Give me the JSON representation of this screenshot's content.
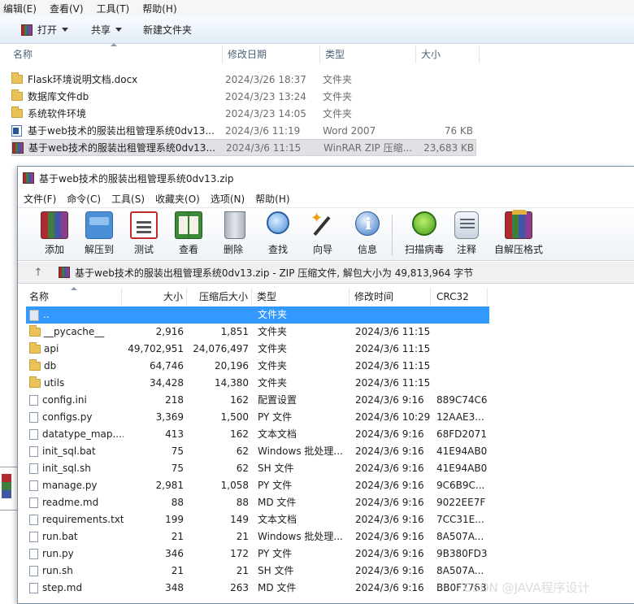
{
  "explorer": {
    "menu": [
      "编辑(E)",
      "查看(V)",
      "工具(T)",
      "帮助(H)"
    ],
    "toolbar": {
      "open": "打开",
      "share": "共享",
      "new_folder": "新建文件夹"
    },
    "columns": {
      "name": "名称",
      "date": "修改日期",
      "type": "类型",
      "size": "大小"
    },
    "rows": [
      {
        "name": "Flask环境说明文档.docx",
        "date": "2024/3/26 18:37",
        "type": "文件夹",
        "size": "",
        "icon": "folder-icon"
      },
      {
        "name": "数据库文件db",
        "date": "2024/3/23 13:24",
        "type": "文件夹",
        "size": "",
        "icon": "folder-icon"
      },
      {
        "name": "系统软件环境",
        "date": "2024/3/23 14:05",
        "type": "文件夹",
        "size": "",
        "icon": "folder-icon"
      },
      {
        "name": "基于web技术的服装出租管理系统0dv13...",
        "date": "2024/3/6 11:19",
        "type": "Word 2007",
        "size": "76 KB",
        "icon": "word-doc-icon"
      },
      {
        "name": "基于web技术的服装出租管理系统0dv13...",
        "date": "2024/3/6 11:15",
        "type": "WinRAR ZIP 压缩...",
        "size": "23,683 KB",
        "icon": "winrar-archive-icon"
      }
    ]
  },
  "winrar": {
    "title": "基于web技术的服装出租管理系统0dv13.zip",
    "menu": [
      "文件(F)",
      "命令(C)",
      "工具(S)",
      "收藏夹(O)",
      "选项(N)",
      "帮助(H)"
    ],
    "tools": [
      {
        "label": "添加",
        "icon": "add-archive-icon"
      },
      {
        "label": "解压到",
        "icon": "extract-to-icon"
      },
      {
        "label": "测试",
        "icon": "test-icon"
      },
      {
        "label": "查看",
        "icon": "view-book-icon"
      },
      {
        "label": "删除",
        "icon": "trash-icon"
      },
      {
        "label": "查找",
        "icon": "magnifier-icon"
      },
      {
        "label": "向导",
        "icon": "wizard-wand-icon"
      },
      {
        "label": "信息",
        "icon": "info-icon"
      },
      {
        "label": "扫描病毒",
        "icon": "virus-scan-icon"
      },
      {
        "label": "注释",
        "icon": "comment-icon"
      },
      {
        "label": "自解压格式",
        "icon": "sfx-icon"
      }
    ],
    "path": "基于web技术的服装出租管理系统0dv13.zip - ZIP 压缩文件, 解包大小为 49,813,964 字节",
    "columns": {
      "name": "名称",
      "size": "大小",
      "packed": "压缩后大小",
      "type": "类型",
      "modified": "修改时间",
      "crc": "CRC32"
    },
    "rows": [
      {
        "name": "..",
        "size": "",
        "packed": "",
        "type": "文件夹",
        "modified": "",
        "crc": "",
        "icon": "parent-folder-icon"
      },
      {
        "name": "__pycache__",
        "size": "2,916",
        "packed": "1,851",
        "type": "文件夹",
        "modified": "2024/3/6 11:15",
        "crc": "",
        "icon": "folder-icon"
      },
      {
        "name": "api",
        "size": "49,702,951",
        "packed": "24,076,497",
        "type": "文件夹",
        "modified": "2024/3/6 11:15",
        "crc": "",
        "icon": "folder-icon"
      },
      {
        "name": "db",
        "size": "64,746",
        "packed": "20,196",
        "type": "文件夹",
        "modified": "2024/3/6 11:15",
        "crc": "",
        "icon": "folder-icon"
      },
      {
        "name": "utils",
        "size": "34,428",
        "packed": "14,380",
        "type": "文件夹",
        "modified": "2024/3/6 11:15",
        "crc": "",
        "icon": "folder-icon"
      },
      {
        "name": "config.ini",
        "size": "218",
        "packed": "162",
        "type": "配置设置",
        "modified": "2024/3/6 9:16",
        "crc": "889C74C6",
        "icon": "config-file-icon"
      },
      {
        "name": "configs.py",
        "size": "3,369",
        "packed": "1,500",
        "type": "PY 文件",
        "modified": "2024/3/6 10:29",
        "crc": "12AAE3...",
        "icon": "file-icon"
      },
      {
        "name": "datatype_map....",
        "size": "413",
        "packed": "162",
        "type": "文本文档",
        "modified": "2024/3/6 9:16",
        "crc": "68FD2071",
        "icon": "file-icon"
      },
      {
        "name": "init_sql.bat",
        "size": "75",
        "packed": "62",
        "type": "Windows 批处理...",
        "modified": "2024/3/6 9:16",
        "crc": "41E94AB0",
        "icon": "batch-file-icon"
      },
      {
        "name": "init_sql.sh",
        "size": "75",
        "packed": "62",
        "type": "SH 文件",
        "modified": "2024/3/6 9:16",
        "crc": "41E94AB0",
        "icon": "file-icon"
      },
      {
        "name": "manage.py",
        "size": "2,981",
        "packed": "1,058",
        "type": "PY 文件",
        "modified": "2024/3/6 9:16",
        "crc": "9C6B9C...",
        "icon": "file-icon"
      },
      {
        "name": "readme.md",
        "size": "88",
        "packed": "88",
        "type": "MD 文件",
        "modified": "2024/3/6 9:16",
        "crc": "9022EE7F",
        "icon": "file-icon"
      },
      {
        "name": "requirements.txt",
        "size": "199",
        "packed": "149",
        "type": "文本文档",
        "modified": "2024/3/6 9:16",
        "crc": "7CC31E...",
        "icon": "file-icon"
      },
      {
        "name": "run.bat",
        "size": "21",
        "packed": "21",
        "type": "Windows 批处理...",
        "modified": "2024/3/6 9:16",
        "crc": "8A507A...",
        "icon": "batch-file-icon"
      },
      {
        "name": "run.py",
        "size": "346",
        "packed": "172",
        "type": "PY 文件",
        "modified": "2024/3/6 9:16",
        "crc": "9B380FD3",
        "icon": "file-icon"
      },
      {
        "name": "run.sh",
        "size": "21",
        "packed": "21",
        "type": "SH 文件",
        "modified": "2024/3/6 9:16",
        "crc": "8A507A...",
        "icon": "file-icon"
      },
      {
        "name": "step.md",
        "size": "348",
        "packed": "263",
        "type": "MD 文件",
        "modified": "2024/3/6 9:16",
        "crc": "BB0F7763",
        "icon": "file-icon"
      }
    ]
  },
  "watermark": "CSDN @JAVA程序设计"
}
